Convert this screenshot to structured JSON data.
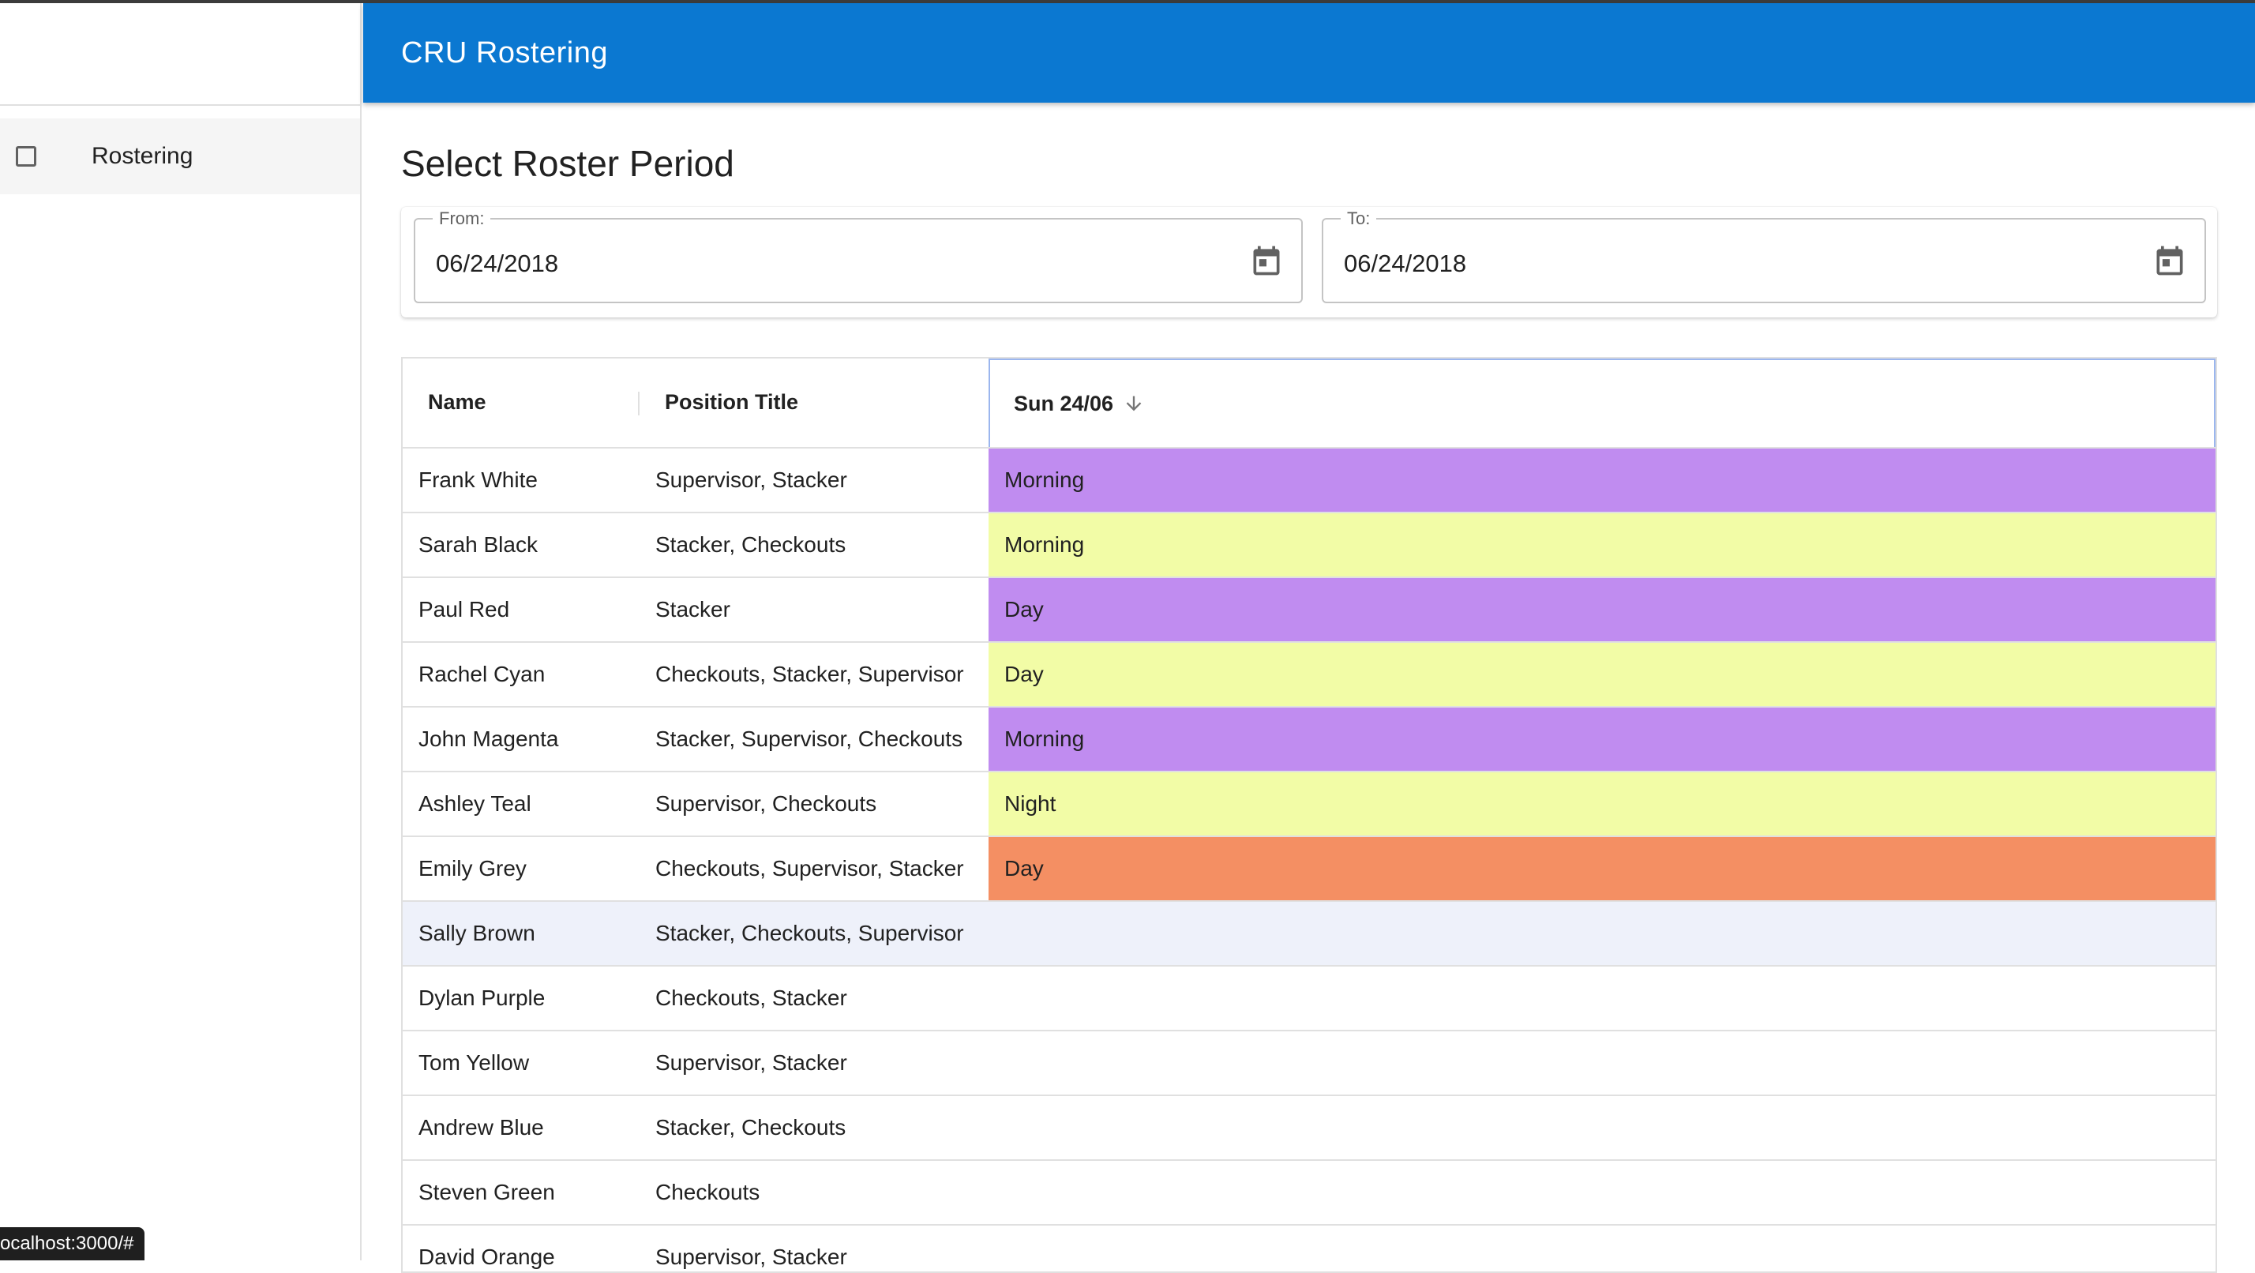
{
  "app": {
    "title": "CRU Rostering"
  },
  "sidebar": {
    "items": [
      {
        "label": "Rostering",
        "icon": "checkbox-icon"
      }
    ]
  },
  "roster_period": {
    "title": "Select Roster Period",
    "from": {
      "label": "From:",
      "value": "06/24/2018",
      "icon": "calendar-icon"
    },
    "to": {
      "label": "To:",
      "value": "06/24/2018",
      "icon": "calendar-icon"
    }
  },
  "grid": {
    "columns": {
      "name": "Name",
      "position": "Position Title",
      "date": "Sun 24/06",
      "sort_icon": "arrow-down-icon"
    },
    "rows": [
      {
        "name": "Frank White",
        "position": "Supervisor, Stacker",
        "shift": "Morning",
        "color": "#c08cf0"
      },
      {
        "name": "Sarah Black",
        "position": "Stacker, Checkouts",
        "shift": "Morning",
        "color": "#f2fca6"
      },
      {
        "name": "Paul Red",
        "position": "Stacker",
        "shift": "Day",
        "color": "#c08cf0"
      },
      {
        "name": "Rachel Cyan",
        "position": "Checkouts, Stacker, Supervisor",
        "shift": "Day",
        "color": "#f2fca6"
      },
      {
        "name": "John Magenta",
        "position": "Stacker, Supervisor, Checkouts",
        "shift": "Morning",
        "color": "#c08cf0"
      },
      {
        "name": "Ashley Teal",
        "position": "Supervisor, Checkouts",
        "shift": "Night",
        "color": "#f2fca6"
      },
      {
        "name": "Emily Grey",
        "position": "Checkouts, Supervisor, Stacker",
        "shift": "Day",
        "color": "#f48f63"
      },
      {
        "name": "Sally Brown",
        "position": "Stacker, Checkouts, Supervisor",
        "shift": "",
        "color": "",
        "selected": true
      },
      {
        "name": "Dylan Purple",
        "position": "Checkouts, Stacker",
        "shift": "",
        "color": ""
      },
      {
        "name": "Tom Yellow",
        "position": "Supervisor, Stacker",
        "shift": "",
        "color": ""
      },
      {
        "name": "Andrew Blue",
        "position": "Stacker, Checkouts",
        "shift": "",
        "color": ""
      },
      {
        "name": "Steven Green",
        "position": "Checkouts",
        "shift": "",
        "color": ""
      },
      {
        "name": "David Orange",
        "position": "Supervisor, Stacker",
        "shift": "",
        "color": ""
      }
    ]
  },
  "status_bar": {
    "url": "ocalhost:3000/#"
  },
  "colors": {
    "appbar": "#0b78d1",
    "shift_purple": "#c08cf0",
    "shift_yellow": "#f2fca6",
    "shift_orange": "#f48f63",
    "selected_row": "#eef1fa"
  }
}
